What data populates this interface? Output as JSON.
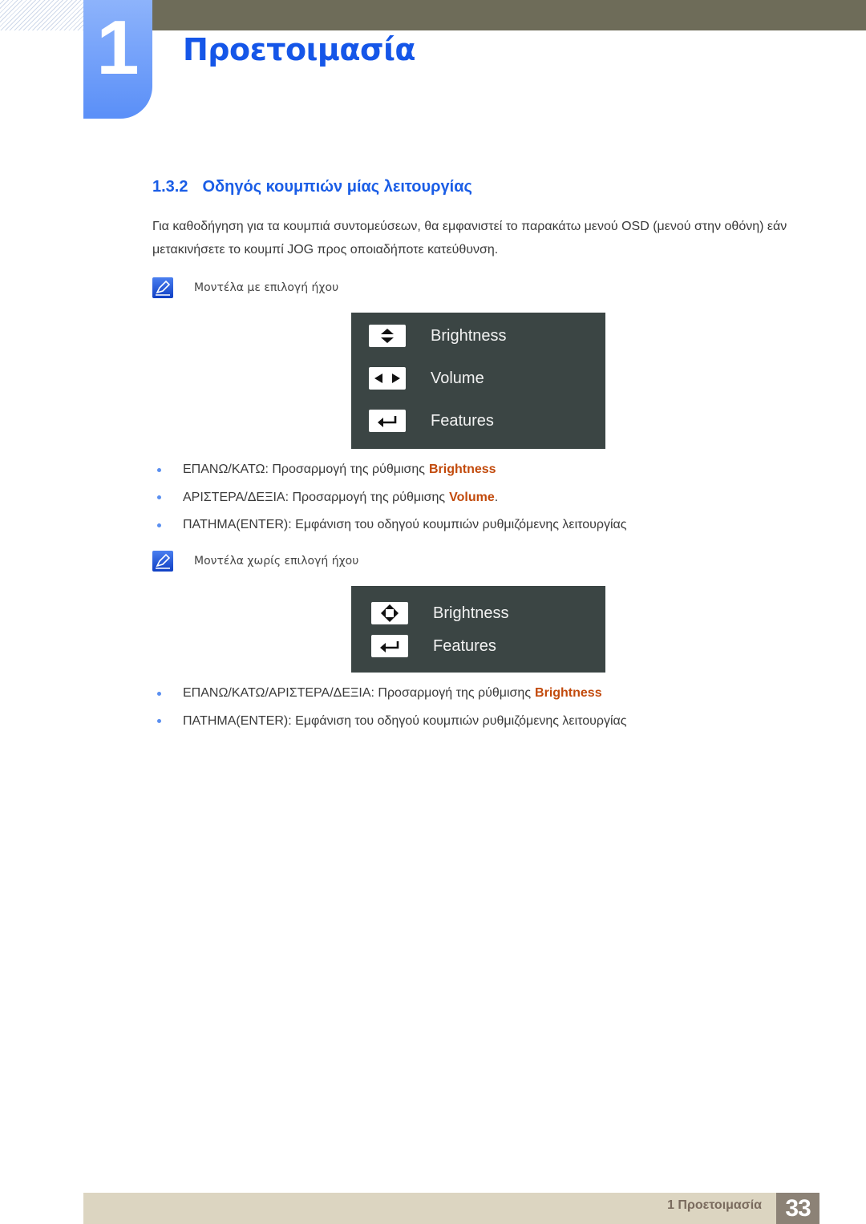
{
  "header": {
    "chapter_number": "1",
    "chapter_title": "Προετοιμασία"
  },
  "section": {
    "number": "1.3.2",
    "title": "Οδηγός κουμπιών μίας λειτουργίας"
  },
  "intro_text": "Για καθοδήγηση για τα κουμπιά συντομεύσεων, θα εμφανιστεί το παρακάτω μενού OSD (μενού στην οθόνη) εάν μετακινήσετε το κουμπί JOG προς οποιαδήποτε κατεύθυνση.",
  "note1": {
    "icon": "note-pencil-icon",
    "text": "Μοντέλα με επιλογή ήχου"
  },
  "osd1": {
    "rows": [
      {
        "icon": "up-down-arrows-icon",
        "label": "Brightness"
      },
      {
        "icon": "left-right-arrows-icon",
        "label": "Volume"
      },
      {
        "icon": "enter-icon",
        "label": "Features"
      }
    ]
  },
  "bullets1": [
    {
      "text": "ΕΠΑΝΩ/ΚΑΤΩ: Προσαρμογή της ρύθμισης",
      "highlight": "Brightness",
      "suffix": ""
    },
    {
      "text": "ΑΡΙΣΤΕΡΑ/ΔΕΞΙΑ: Προσαρμογή της ρύθμισης",
      "highlight": "Volume",
      "suffix": "."
    },
    {
      "text": "ΠΑΤΗΜΑ(ENTER): Εμφάνιση του οδηγού κουμπιών ρυθμιζόμενης λειτουργίας",
      "highlight": "",
      "suffix": ""
    }
  ],
  "note2": {
    "icon": "note-pencil-icon",
    "text": "Μοντέλα χωρίς επιλογή ήχου"
  },
  "osd2": {
    "rows": [
      {
        "icon": "four-way-arrows-icon",
        "label": "Brightness"
      },
      {
        "icon": "enter-icon",
        "label": "Features"
      }
    ]
  },
  "bullets2": [
    {
      "text": "ΕΠΑΝΩ/ΚΑΤΩ/ΑΡΙΣΤΕΡΑ/ΔΕΞΙΑ: Προσαρμογή της ρύθμισης",
      "highlight": "Brightness",
      "suffix": ""
    },
    {
      "text": "ΠΑΤΗΜΑ(ENTER): Εμφάνιση του οδηγού κουμπιών ρυθμιζόμενης λειτουργίας",
      "highlight": "",
      "suffix": ""
    }
  ],
  "footer": {
    "chapter_label": "1 Προετοιμασία",
    "page_number": "33"
  },
  "colors": {
    "accent_blue": "#1a5de6",
    "highlight_orange": "#c24a0c",
    "osd_bg": "#3b4544",
    "top_bar": "#6e6c59",
    "footer_bar": "#dcd5c1",
    "page_box": "#8c8276"
  }
}
